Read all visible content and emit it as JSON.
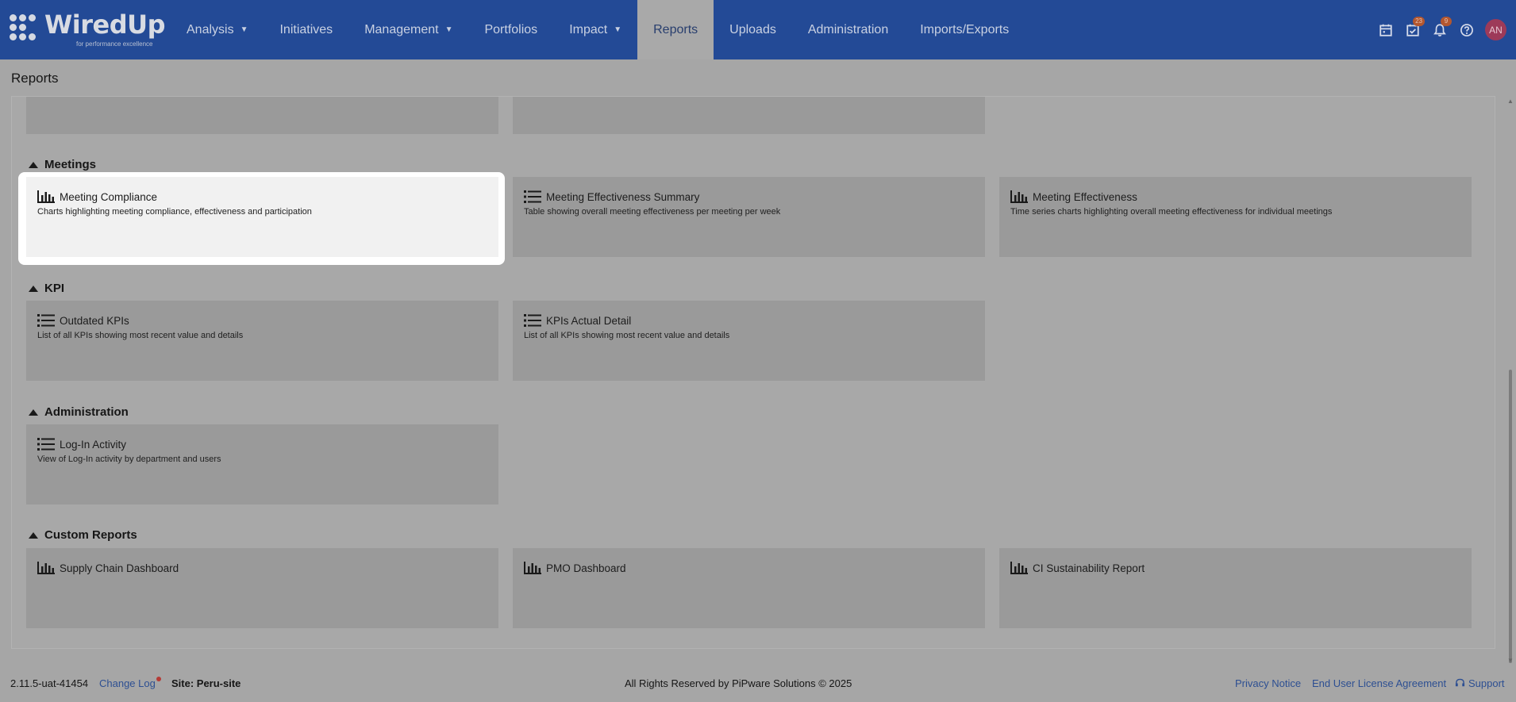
{
  "app": {
    "logo_text": "WiredUp",
    "logo_tagline": "for performance excellence"
  },
  "nav": {
    "items": [
      {
        "label": "Analysis",
        "dropdown": true
      },
      {
        "label": "Initiatives",
        "dropdown": false
      },
      {
        "label": "Management",
        "dropdown": true
      },
      {
        "label": "Portfolios",
        "dropdown": false
      },
      {
        "label": "Impact",
        "dropdown": true
      },
      {
        "label": "Reports",
        "dropdown": false,
        "active": true
      },
      {
        "label": "Uploads",
        "dropdown": false
      },
      {
        "label": "Administration",
        "dropdown": false
      },
      {
        "label": "Imports/Exports",
        "dropdown": false
      }
    ],
    "caret": "▼",
    "tools": {
      "calendar_icon": "calendar-icon",
      "tasks_badge": "23",
      "notifications_badge": "9",
      "help_icon": "help-icon",
      "avatar_initials": "AN"
    }
  },
  "page": {
    "title": "Reports"
  },
  "sections": {
    "meetings": {
      "heading": "Meetings",
      "cards": [
        {
          "title": "Meeting Compliance",
          "description": "Charts highlighting meeting compliance, effectiveness and participation",
          "icon": "bar-chart-icon"
        },
        {
          "title": "Meeting Effectiveness Summary",
          "description": "Table showing overall meeting effectiveness per meeting per week",
          "icon": "list-icon"
        },
        {
          "title": "Meeting Effectiveness",
          "description": "Time series charts highlighting overall meeting effectiveness for individual meetings",
          "icon": "bar-chart-icon"
        }
      ]
    },
    "kpi": {
      "heading": "KPI",
      "cards": [
        {
          "title": "Outdated KPIs",
          "description": "List of all KPIs showing most recent value and details",
          "icon": "list-icon"
        },
        {
          "title": "KPIs Actual Detail",
          "description": "List of all KPIs showing most recent value and details",
          "icon": "list-icon"
        }
      ]
    },
    "administration": {
      "heading": "Administration",
      "cards": [
        {
          "title": "Log-In Activity",
          "description": "View of Log-In activity by department and users",
          "icon": "list-icon"
        }
      ]
    },
    "custom": {
      "heading": "Custom Reports",
      "cards": [
        {
          "title": "Supply Chain Dashboard",
          "icon": "bar-chart-icon"
        },
        {
          "title": "PMO Dashboard",
          "icon": "bar-chart-icon"
        },
        {
          "title": "CI Sustainability Report",
          "icon": "bar-chart-icon"
        }
      ]
    }
  },
  "footer": {
    "version": "2.11.5-uat-41454",
    "change_log": "Change Log",
    "site": "Site: Peru-site",
    "rights": "All Rights Reserved by PiPware Solutions © 2025",
    "privacy": "Privacy Notice",
    "eula": "End User License Agreement",
    "support": "Support"
  },
  "colors": {
    "nav_bg": "#234a96",
    "highlight": "#ffffff",
    "link": "#2d4f92",
    "badge": "#b4572f",
    "avatar": "#9d3a59"
  }
}
